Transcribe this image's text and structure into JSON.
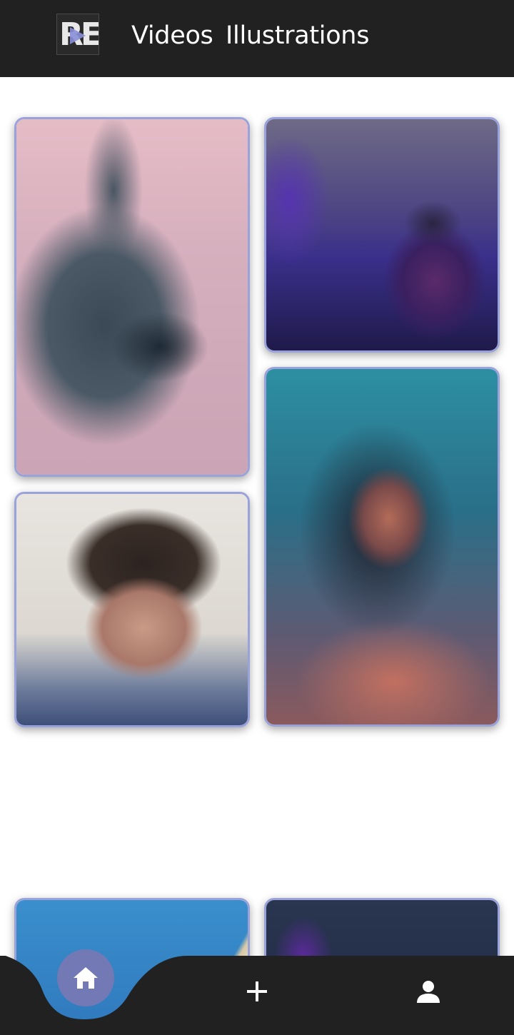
{
  "header": {
    "logo_text": "RE",
    "tabs": [
      {
        "label": "Videos"
      },
      {
        "label": "Illustrations"
      }
    ]
  },
  "feed": {
    "cards": [
      {
        "name": "cat-photo"
      },
      {
        "name": "guitarist-photo"
      },
      {
        "name": "girl-portrait-photo"
      },
      {
        "name": "boy-selfie-photo"
      },
      {
        "name": "sky-building-photo"
      },
      {
        "name": "dark-purple-photo"
      }
    ]
  },
  "bottom_nav": {
    "items": [
      "home-icon",
      "plus-icon",
      "person-icon"
    ]
  },
  "colors": {
    "header_bg": "#212121",
    "nav_bg": "#212121",
    "accent": "#7279b4",
    "card_border": "#9aa2da"
  }
}
